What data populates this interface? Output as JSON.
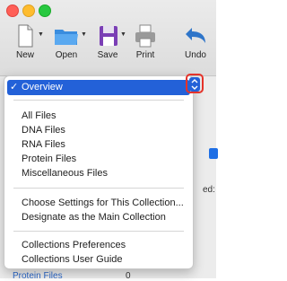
{
  "toolbar": {
    "new_label": "New",
    "open_label": "Open",
    "save_label": "Save",
    "print_label": "Print",
    "undo_label": "Undo"
  },
  "collection_menu": {
    "selected": "Overview",
    "file_types": [
      "All Files",
      "DNA Files",
      "RNA Files",
      "Protein Files",
      "Miscellaneous Files"
    ],
    "collection_actions": [
      "Choose Settings for This Collection...",
      "Designate as the Main Collection"
    ],
    "help_items": [
      "Collections Preferences",
      "Collections User Guide"
    ]
  },
  "background": {
    "partial_text": "ed:",
    "list_item_partial": "Protein Files",
    "count_partial": "0"
  },
  "colors": {
    "selection": "#2361d8",
    "highlight_outline": "#e5332a"
  }
}
